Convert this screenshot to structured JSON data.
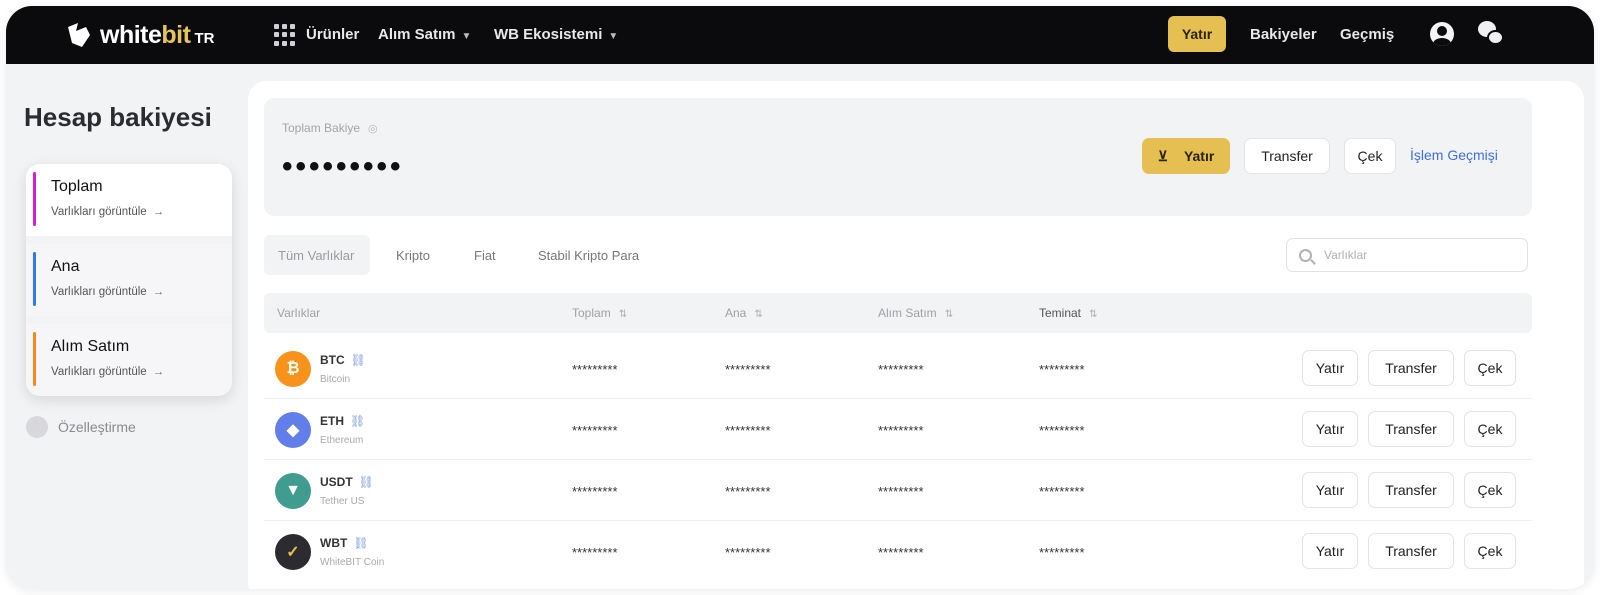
{
  "nav": {
    "logo_white": "white",
    "logo_bit": "bit",
    "logo_tr": "TR",
    "menu": [
      {
        "label": "Ürünler"
      },
      {
        "label": "Alım Satım"
      },
      {
        "label": "WB Ekosistemi"
      }
    ],
    "deposit": "Yatır",
    "balances": "Bakiyeler",
    "history": "Geçmiş"
  },
  "sidebar": {
    "title": "Hesap bakiyesi",
    "items": [
      {
        "label": "Toplam",
        "sub": "Varlıkları görüntüle",
        "accent": "#d61fd0"
      },
      {
        "label": "Ana",
        "sub": "Varlıkları görüntüle",
        "accent": "#2f7bea"
      },
      {
        "label": "Alım Satım",
        "sub": "Varlıkları görüntüle",
        "accent": "#f08a1a"
      }
    ],
    "customize": "Özelleştirme"
  },
  "balance": {
    "label": "Toplam Bakiye",
    "value": "•••••••••",
    "deposit": "Yatır",
    "transfer": "Transfer",
    "withdraw": "Çek",
    "history_link": "İşlem Geçmişi"
  },
  "tabs": [
    "Tüm Varlıklar",
    "Kripto",
    "Fiat",
    "Stabil Kripto Para"
  ],
  "search": {
    "placeholder": "Varlıklar"
  },
  "table": {
    "headers": [
      "Varlıklar",
      "Toplam",
      "Ana",
      "Alım Satım",
      "Teminat"
    ],
    "rows": [
      {
        "symbol": "BTC",
        "name": "Bitcoin",
        "color": "#f7931a",
        "glyph": "₿",
        "total": "*********",
        "main": "*********",
        "trade": "*********",
        "collateral": "*********"
      },
      {
        "symbol": "ETH",
        "name": "Ethereum",
        "color": "#627eea",
        "glyph": "◆",
        "total": "*********",
        "main": "*********",
        "trade": "*********",
        "collateral": "*********"
      },
      {
        "symbol": "USDT",
        "name": "Tether US",
        "color": "#3f9c8f",
        "glyph": "▼",
        "total": "*********",
        "main": "*********",
        "trade": "*********",
        "collateral": "*********"
      },
      {
        "symbol": "WBT",
        "name": "WhiteBIT Coin",
        "color": "#2c2c30",
        "glyph": "✓",
        "total": "*********",
        "main": "*********",
        "trade": "*********",
        "collateral": "*********"
      }
    ],
    "actions": {
      "deposit": "Yatır",
      "transfer": "Transfer",
      "withdraw": "Çek"
    }
  }
}
